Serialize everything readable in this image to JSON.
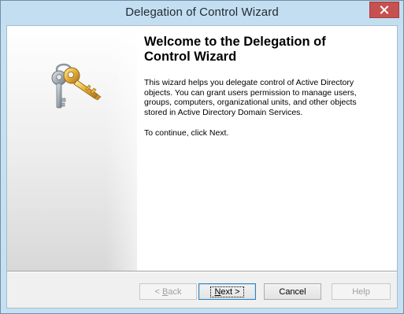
{
  "window": {
    "title": "Delegation of Control Wizard"
  },
  "icons": {
    "close": "close-icon",
    "keys": "keys-icon"
  },
  "content": {
    "heading": "Welcome to the Delegation of Control Wizard",
    "description": "This wizard helps you delegate control of Active Directory objects. You can grant users permission to manage users, groups, computers, organizational units, and other objects stored in Active Directory Domain Services.",
    "continue_text": "To continue, click Next."
  },
  "buttons": {
    "back": {
      "prefix": "< ",
      "accel": "B",
      "rest": "ack",
      "enabled": false
    },
    "next": {
      "accel": "N",
      "rest": "ext >",
      "enabled": true,
      "default": true
    },
    "cancel": {
      "label": "Cancel",
      "enabled": true
    },
    "help": {
      "label": "Help",
      "enabled": false
    }
  },
  "colors": {
    "titlebar": "#c4def1",
    "close_button": "#c75050",
    "default_button_border": "#3c7fb1",
    "key_gold": "#e8b43a",
    "key_silver": "#a9b1b9"
  }
}
